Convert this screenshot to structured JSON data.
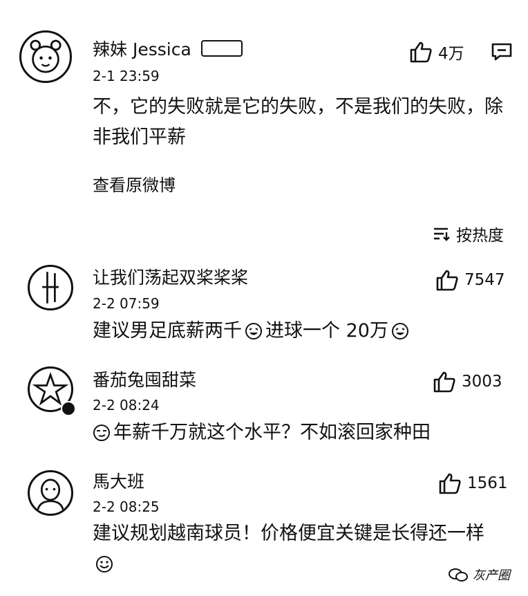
{
  "top_comment": {
    "username": "辣妹 Jessica",
    "time": "2-1 23:59",
    "likes": "4万",
    "text": "不，它的失败就是它的失败，不是我们的失败，除非我们平薪",
    "view_original": "查看原微博"
  },
  "sort_label": "按热度",
  "comments": [
    {
      "username": "让我们荡起双桨桨桨",
      "time": "2-2 07:59",
      "likes": "7547",
      "text_a": "建议男足底薪两千",
      "text_b": "进球一个 20万"
    },
    {
      "username": "番茄兔囤甜菜",
      "time": "2-2 08:24",
      "likes": "3003",
      "text": "年薪千万就这个水平？不如滚回家种田"
    },
    {
      "username": "馬大班",
      "time": "2-2 08:25",
      "likes": "1561",
      "text": "建议规划越南球员！价格便宜关键是长得还一样"
    }
  ],
  "watermark": "灰产圈"
}
